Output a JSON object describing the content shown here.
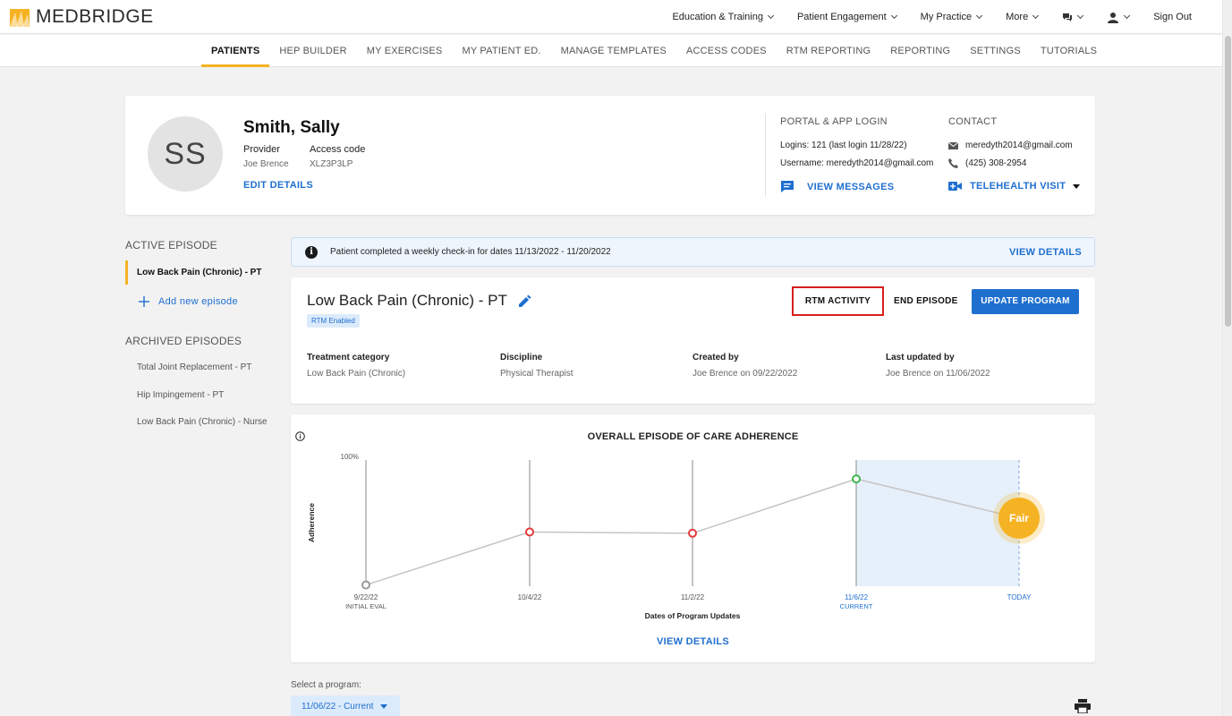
{
  "brand": {
    "name": "MEDBRIDGE",
    "accent": "#f5b324",
    "primary": "#1f6fcf"
  },
  "topnav": {
    "items": [
      {
        "label": "Education & Training"
      },
      {
        "label": "Patient Engagement"
      },
      {
        "label": "My Practice"
      },
      {
        "label": "More"
      }
    ],
    "sign_out": "Sign Out"
  },
  "subnav": [
    "PATIENTS",
    "HEP BUILDER",
    "MY EXERCISES",
    "MY PATIENT ED.",
    "MANAGE TEMPLATES",
    "ACCESS CODES",
    "RTM REPORTING",
    "REPORTING",
    "SETTINGS",
    "TUTORIALS"
  ],
  "patient": {
    "initials": "SS",
    "name": "Smith, Sally",
    "provider_label": "Provider",
    "provider": "Joe Brence",
    "access_label": "Access code",
    "access_code": "XLZ3P3LP",
    "edit": "EDIT DETAILS",
    "portal_title": "PORTAL & APP LOGIN",
    "logins": "Logins: 121 (last login 11/28/22)",
    "username": "Username: meredyth2014@gmail.com",
    "view_messages": "VIEW MESSAGES",
    "contact_title": "CONTACT",
    "email": "meredyth2014@gmail.com",
    "phone": "(425) 308-2954",
    "telehealth": "TELEHEALTH VISIT"
  },
  "sidebar": {
    "active_title": "ACTIVE EPISODE",
    "active_item": "Low Back Pain (Chronic) - PT",
    "add": "Add new episode",
    "archived_title": "ARCHIVED EPISODES",
    "archived": [
      "Total Joint Replacement - PT",
      "Hip Impingement - PT",
      "Low Back Pain (Chronic) - Nurse"
    ]
  },
  "banner": {
    "text": "Patient completed a weekly check-in for dates 11/13/2022 - 11/20/2022",
    "link": "VIEW DETAILS"
  },
  "episode": {
    "title": "Low Back Pain (Chronic) - PT",
    "badge": "RTM Enabled",
    "rtm_activity": "RTM ACTIVITY",
    "end_episode": "END EPISODE",
    "update_program": "UPDATE PROGRAM",
    "meta": [
      {
        "label": "Treatment category",
        "value": "Low Back Pain (Chronic)"
      },
      {
        "label": "Discipline",
        "value": "Physical Therapist"
      },
      {
        "label": "Created by",
        "value": "Joe Brence on 09/22/2022"
      },
      {
        "label": "Last updated by",
        "value": "Joe Brence on 11/06/2022"
      }
    ]
  },
  "chart_data": {
    "type": "line",
    "title": "OVERALL EPISODE OF CARE ADHERENCE",
    "xlabel": "Dates of Program Updates",
    "ylabel": "Adherence",
    "ytick_top": "100%",
    "ylim": [
      0,
      100
    ],
    "categories": [
      "9/22/22",
      "10/4/22",
      "11/2/22",
      "11/6/22",
      "TODAY"
    ],
    "sublabels": [
      "INITIAL EVAL",
      "",
      "",
      "CURRENT",
      ""
    ],
    "values": [
      1,
      43,
      42,
      85,
      54
    ],
    "point_colors": [
      "#9a9a9a",
      "#e23b3b",
      "#e23b3b",
      "#39b54a",
      "#f5b324"
    ],
    "today_status": "Fair",
    "view_details": "VIEW DETAILS"
  },
  "program": {
    "label": "Select a program:",
    "selected": "11/06/22 - Current"
  }
}
